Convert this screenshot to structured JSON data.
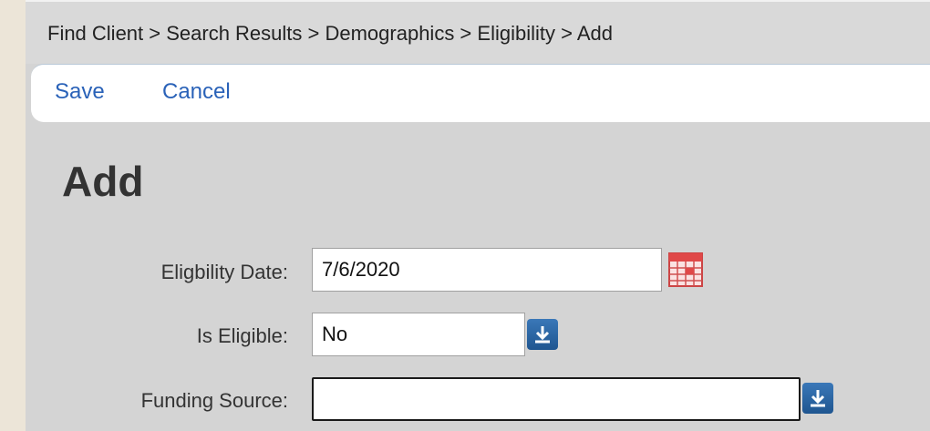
{
  "breadcrumb": {
    "text": "Find Client > Search Results > Demographics > Eligibility > Add"
  },
  "toolbar": {
    "save_label": "Save",
    "cancel_label": "Cancel"
  },
  "page": {
    "title": "Add"
  },
  "form": {
    "eligibility_date": {
      "label": "Eligbility Date:",
      "value": "7/6/2020",
      "icon": "calendar-icon"
    },
    "is_eligible": {
      "label": "Is Eligible:",
      "value": "No",
      "icon": "dropdown-arrow-icon"
    },
    "funding_source": {
      "label": "Funding Source:",
      "value": "",
      "icon": "dropdown-arrow-icon"
    }
  },
  "colors": {
    "accent_link": "#2a62b8",
    "dropdown_button": "#2a6aa8",
    "panel_background": "#d4d4d4",
    "outer_background": "#ece5d8"
  }
}
